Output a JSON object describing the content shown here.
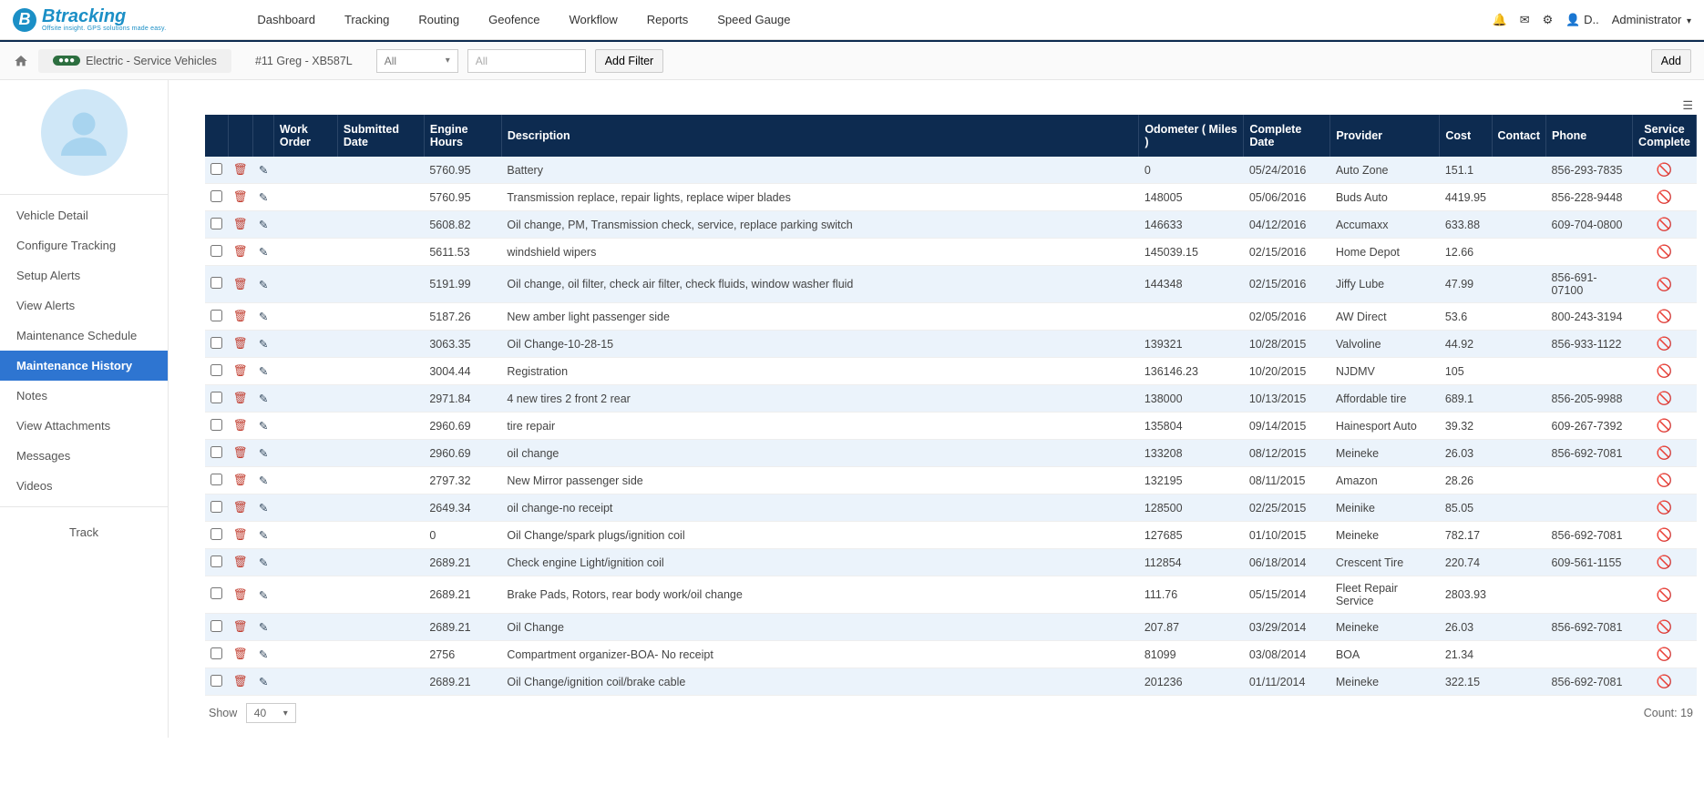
{
  "header": {
    "brand": "Btracking",
    "brand_sub": "Offsite insight. GPS solutions made easy.",
    "nav": [
      "Dashboard",
      "Tracking",
      "Routing",
      "Geofence",
      "Workflow",
      "Reports",
      "Speed Gauge"
    ],
    "user_short": "D..",
    "role": "Administrator"
  },
  "crumb": {
    "group": "Electric - Service Vehicles",
    "vehicle": "#11 Greg - XB587L",
    "filter_select": "All",
    "filter_input_placeholder": "All",
    "add_filter": "Add Filter",
    "add": "Add"
  },
  "sidebar": {
    "items": [
      "Vehicle Detail",
      "Configure Tracking",
      "Setup Alerts",
      "View Alerts",
      "Maintenance Schedule",
      "Maintenance History",
      "Notes",
      "View Attachments",
      "Messages",
      "Videos"
    ],
    "active_index": 5,
    "track": "Track"
  },
  "table": {
    "headers": [
      "",
      "",
      "",
      "Work Order",
      "Submitted Date",
      "Engine Hours",
      "Description",
      "Odometer ( Miles )",
      "Complete Date",
      "Provider",
      "Cost",
      "Contact",
      "Phone",
      "Service Complete"
    ],
    "rows": [
      {
        "eng": "5760.95",
        "desc": "Battery",
        "odo": "0",
        "cd": "05/24/2016",
        "prov": "Auto Zone",
        "cost": "151.1",
        "phone": "856-293-7835"
      },
      {
        "eng": "5760.95",
        "desc": "Transmission replace, repair lights, replace wiper blades",
        "odo": "148005",
        "cd": "05/06/2016",
        "prov": "Buds Auto",
        "cost": "4419.95",
        "phone": "856-228-9448"
      },
      {
        "eng": "5608.82",
        "desc": "Oil change, PM, Transmission check, service, replace parking switch",
        "odo": "146633",
        "cd": "04/12/2016",
        "prov": "Accumaxx",
        "cost": "633.88",
        "phone": "609-704-0800"
      },
      {
        "eng": "5611.53",
        "desc": "windshield wipers",
        "odo": "145039.15",
        "cd": "02/15/2016",
        "prov": "Home Depot",
        "cost": "12.66",
        "phone": ""
      },
      {
        "eng": "5191.99",
        "desc": "Oil change, oil filter, check air filter, check fluids, window washer fluid",
        "odo": "144348",
        "cd": "02/15/2016",
        "prov": "Jiffy Lube",
        "cost": "47.99",
        "phone": "856-691-07100"
      },
      {
        "eng": "5187.26",
        "desc": "New amber light passenger side",
        "odo": "",
        "cd": "02/05/2016",
        "prov": "AW Direct",
        "cost": "53.6",
        "phone": "800-243-3194"
      },
      {
        "eng": "3063.35",
        "desc": "Oil Change-10-28-15",
        "odo": "139321",
        "cd": "10/28/2015",
        "prov": "Valvoline",
        "cost": "44.92",
        "phone": "856-933-1122"
      },
      {
        "eng": "3004.44",
        "desc": "Registration",
        "odo": "136146.23",
        "cd": "10/20/2015",
        "prov": "NJDMV",
        "cost": "105",
        "phone": ""
      },
      {
        "eng": "2971.84",
        "desc": "4 new tires 2 front 2 rear",
        "odo": "138000",
        "cd": "10/13/2015",
        "prov": "Affordable tire",
        "cost": "689.1",
        "phone": "856-205-9988"
      },
      {
        "eng": "2960.69",
        "desc": "tire repair",
        "odo": "135804",
        "cd": "09/14/2015",
        "prov": "Hainesport Auto",
        "cost": "39.32",
        "phone": "609-267-7392"
      },
      {
        "eng": "2960.69",
        "desc": "oil change",
        "odo": "133208",
        "cd": "08/12/2015",
        "prov": "Meineke",
        "cost": "26.03",
        "phone": "856-692-7081"
      },
      {
        "eng": "2797.32",
        "desc": "New Mirror passenger side",
        "odo": "132195",
        "cd": "08/11/2015",
        "prov": "Amazon",
        "cost": "28.26",
        "phone": ""
      },
      {
        "eng": "2649.34",
        "desc": "oil change-no receipt",
        "odo": "128500",
        "cd": "02/25/2015",
        "prov": "Meinike",
        "cost": "85.05",
        "phone": ""
      },
      {
        "eng": "0",
        "desc": "Oil Change/spark plugs/ignition coil",
        "odo": "127685",
        "cd": "01/10/2015",
        "prov": "Meineke",
        "cost": "782.17",
        "phone": "856-692-7081"
      },
      {
        "eng": "2689.21",
        "desc": "Check engine Light/ignition coil",
        "odo": "112854",
        "cd": "06/18/2014",
        "prov": "Crescent Tire",
        "cost": "220.74",
        "phone": "609-561-1155"
      },
      {
        "eng": "2689.21",
        "desc": "Brake Pads, Rotors, rear body work/oil change",
        "odo": "111.76",
        "cd": "05/15/2014",
        "prov": "Fleet Repair Service",
        "cost": "2803.93",
        "phone": ""
      },
      {
        "eng": "2689.21",
        "desc": "Oil Change",
        "odo": "207.87",
        "cd": "03/29/2014",
        "prov": "Meineke",
        "cost": "26.03",
        "phone": "856-692-7081"
      },
      {
        "eng": "2756",
        "desc": "Compartment organizer-BOA- No receipt",
        "odo": "81099",
        "cd": "03/08/2014",
        "prov": "BOA",
        "cost": "21.34",
        "phone": ""
      },
      {
        "eng": "2689.21",
        "desc": "Oil Change/ignition coil/brake cable",
        "odo": "201236",
        "cd": "01/11/2014",
        "prov": "Meineke",
        "cost": "322.15",
        "phone": "856-692-7081"
      }
    ]
  },
  "footer": {
    "show": "Show",
    "per_page": "40",
    "count_label": "Count: 19"
  }
}
